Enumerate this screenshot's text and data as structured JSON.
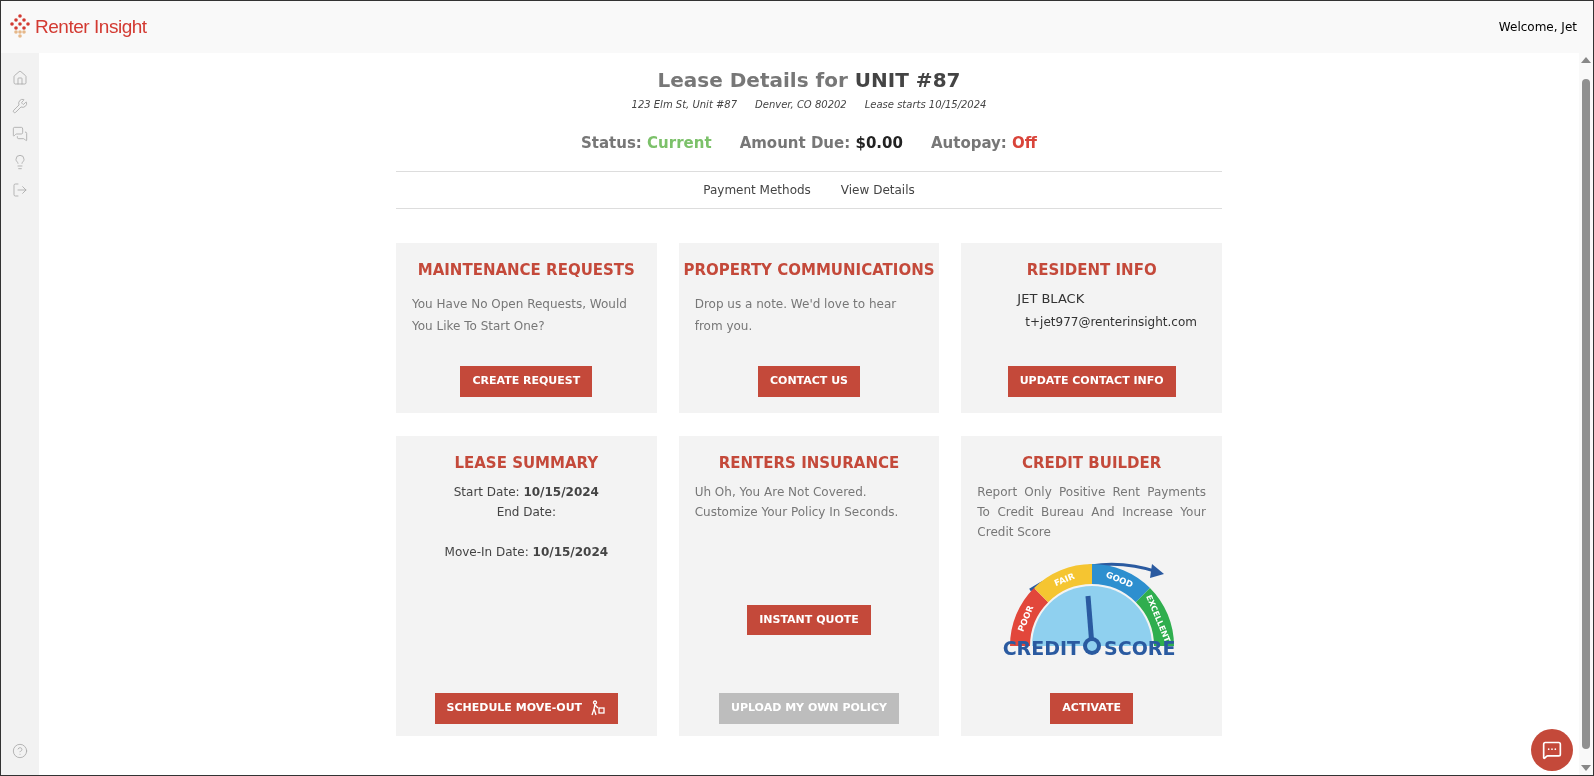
{
  "header": {
    "brand": "Renter Insight",
    "welcome": "Welcome, Jet"
  },
  "lease": {
    "title_prefix": "Lease Details for",
    "unit": "UNIT #87",
    "address": "123 Elm St, Unit #87",
    "city": "Denver, CO 80202",
    "lease_start": "Lease starts 10/15/2024",
    "status_items": [
      {
        "label": "Status:",
        "value": "Current",
        "color": "#7cc16a"
      },
      {
        "label": "Amount Due:",
        "value": "$0.00",
        "color": "#222222"
      },
      {
        "label": "Autopay:",
        "value": "Off",
        "color": "#d9443a"
      }
    ],
    "links": [
      "Payment Methods",
      "View Details"
    ]
  },
  "cards": [
    {
      "kind": "text",
      "title": "MAINTENANCE REQUESTS",
      "text": "You Have No Open Requests, Would You Like To Start One?",
      "buttons": [
        {
          "label": "CREATE REQUEST",
          "disabled": false
        }
      ]
    },
    {
      "kind": "text",
      "title": "PROPERTY COMMUNICATIONS",
      "text": "Drop us a note. We'd love to hear from you.",
      "buttons": [
        {
          "label": "CONTACT US",
          "disabled": false
        }
      ]
    },
    {
      "kind": "resident",
      "title": "RESIDENT INFO",
      "name": "JET BLACK",
      "email": "t+jet977@renterinsight.com",
      "buttons": [
        {
          "label": "UPDATE CONTACT INFO",
          "disabled": false
        }
      ]
    },
    {
      "kind": "summary",
      "title": "LEASE SUMMARY",
      "rows": [
        {
          "label": "Start Date:",
          "value": "10/15/2024"
        },
        {
          "label": "End Date:",
          "value": ""
        },
        {
          "label": "Move-In Date:",
          "value": "10/15/2024"
        }
      ],
      "buttons": [
        {
          "label": "SCHEDULE MOVE-OUT",
          "disabled": false
        }
      ]
    },
    {
      "kind": "insurance",
      "title": "RENTERS INSURANCE",
      "text": "Uh Oh, You Are Not Covered. Customize Your Policy In Seconds.",
      "buttons": [
        {
          "label": "INSTANT QUOTE",
          "disabled": false
        },
        {
          "label": "UPLOAD MY OWN POLICY",
          "disabled": true
        }
      ]
    },
    {
      "kind": "credit",
      "title": "CREDIT BUILDER",
      "text": "Report Only Positive Rent Payments To Credit Bureau And Increase Your Credit Score",
      "gauge_labels": [
        "POOR",
        "FAIR",
        "GOOD",
        "EXCELLENT"
      ],
      "gauge_title": [
        "CREDIT",
        "SCORE"
      ],
      "buttons": [
        {
          "label": "ACTIVATE",
          "disabled": false
        }
      ]
    }
  ]
}
